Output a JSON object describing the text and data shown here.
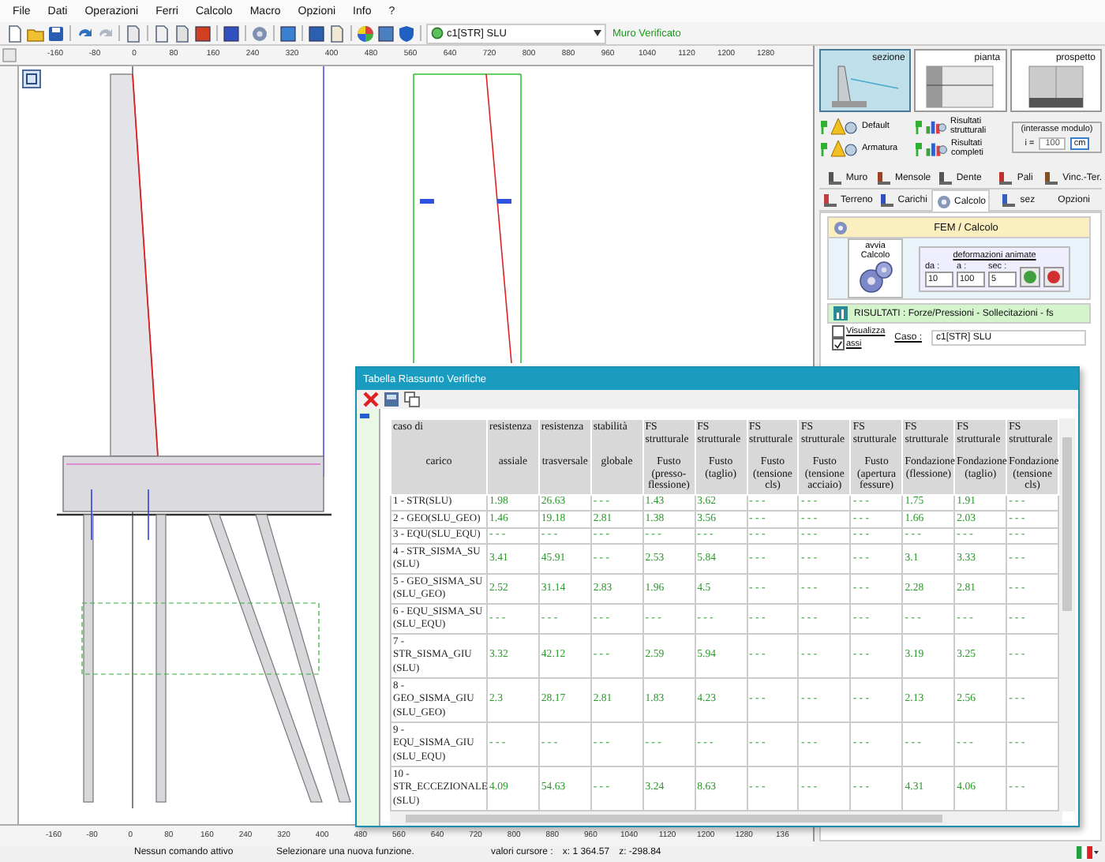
{
  "menu": [
    "File",
    "Dati",
    "Operazioni",
    "Ferri",
    "Calcolo",
    "Macro",
    "Opzioni",
    "Info",
    "?"
  ],
  "toolbar": {
    "case_select": "c1[STR] SLU",
    "status": "Muro Verificato"
  },
  "ruler": {
    "top_labels": [
      "-160",
      "-80",
      "0",
      "80",
      "160",
      "240",
      "320",
      "400",
      "480",
      "560",
      "640",
      "720",
      "800",
      "880",
      "960",
      "1040",
      "1120",
      "1200",
      "1280"
    ],
    "bottom_labels": [
      "-160",
      "-80",
      "0",
      "80",
      "160",
      "240",
      "320",
      "400",
      "480",
      "560",
      "640",
      "720",
      "800",
      "880",
      "960",
      "1040",
      "1120",
      "1200",
      "1280",
      "136"
    ]
  },
  "views": [
    {
      "label": "sezione",
      "selected": true
    },
    {
      "label": "pianta",
      "selected": false
    },
    {
      "label": "prospetto",
      "selected": false
    }
  ],
  "display_buttons": [
    {
      "label": "Default"
    },
    {
      "label": "Risultati strutturali"
    },
    {
      "label": "Armatura"
    },
    {
      "label": "Risultati completi"
    }
  ],
  "module_spacing": {
    "label": "(interasse modulo)",
    "symbol": "i =",
    "value": "100",
    "unit": "cm"
  },
  "tab_rows": [
    {
      "tabs": [
        {
          "label": "Muro",
          "kind": "icon",
          "selected": false
        },
        {
          "label": "Mensole",
          "kind": "icon",
          "selected": false
        },
        {
          "label": "Dente",
          "kind": "icon",
          "selected": false
        },
        {
          "label": "Pali",
          "kind": "icon",
          "selected": false
        },
        {
          "label": "Vinc.-Ter.",
          "kind": "icon",
          "selected": false
        }
      ]
    },
    {
      "tabs": [
        {
          "label": "Terreno",
          "kind": "icon",
          "selected": false
        },
        {
          "label": "Carichi",
          "kind": "icon",
          "selected": false
        },
        {
          "label": "Calcolo",
          "kind": "icon",
          "selected": true
        },
        {
          "label": "sez",
          "kind": "icon",
          "selected": false
        },
        {
          "label": "Opzioni",
          "kind": "text",
          "selected": false
        }
      ]
    }
  ],
  "calc_panel": {
    "title": "FEM / Calcolo",
    "start_button": "avvia Calcolo",
    "animation_title": "deformazioni animate",
    "fields": [
      {
        "label": "da :",
        "value": "10"
      },
      {
        "label": "a :",
        "value": "100"
      },
      {
        "label": "sec :",
        "value": "5"
      }
    ]
  },
  "results_panel": {
    "title": "RISULTATI : Forze/Pressioni - Sollecitazioni - fs",
    "options": [
      {
        "label": "Visualizza",
        "checked": false
      },
      {
        "label": "assi",
        "checked": true
      }
    ],
    "case_label": "Caso :",
    "case_value": "c1[STR] SLU"
  },
  "table_window": {
    "title": "Tabella Riassunto Verifiche",
    "columns": [
      {
        "top": "caso di",
        "bottom": "carico"
      },
      {
        "top": "resistenza",
        "bottom": "assiale"
      },
      {
        "top": "resistenza",
        "bottom": "trasversale"
      },
      {
        "top": "stabilità",
        "bottom": "globale"
      },
      {
        "top": "FS strutturale",
        "bottom": "Fusto (presso-flessione)"
      },
      {
        "top": "FS strutturale",
        "bottom": "Fusto (taglio)"
      },
      {
        "top": "FS strutturale",
        "bottom": "Fusto (tensione cls)"
      },
      {
        "top": "FS strutturale",
        "bottom": "Fusto (tensione acciaio)"
      },
      {
        "top": "FS strutturale",
        "bottom": "Fusto (apertura fessure)"
      },
      {
        "top": "FS strutturale",
        "bottom": "Fondazione (flessione)"
      },
      {
        "top": "FS strutturale",
        "bottom": "Fondazione (taglio)"
      },
      {
        "top": "FS strutturale",
        "bottom": "Fondazione (tensione cls)"
      }
    ],
    "rows": [
      {
        "case": "1 - STR(SLU)",
        "values": [
          "1.98",
          "26.63",
          "- - -",
          "1.43",
          "3.62",
          "- - -",
          "- - -",
          "- - -",
          "1.75",
          "1.91",
          "- - -"
        ]
      },
      {
        "case": "2 - GEO(SLU_GEO)",
        "values": [
          "1.46",
          "19.18",
          "2.81",
          "1.38",
          "3.56",
          "- - -",
          "- - -",
          "- - -",
          "1.66",
          "2.03",
          "- - -"
        ]
      },
      {
        "case": "3 - EQU(SLU_EQU)",
        "values": [
          "- - -",
          "- - -",
          "- - -",
          "- - -",
          "- - -",
          "- - -",
          "- - -",
          "- - -",
          "- - -",
          "- - -",
          "- - -"
        ]
      },
      {
        "case": "4 - STR_SISMA_SU (SLU)",
        "values": [
          "3.41",
          "45.91",
          "- - -",
          "2.53",
          "5.84",
          "- - -",
          "- - -",
          "- - -",
          "3.1",
          "3.33",
          "- - -"
        ]
      },
      {
        "case": "5 - GEO_SISMA_SU (SLU_GEO)",
        "values": [
          "2.52",
          "31.14",
          "2.83",
          "1.96",
          "4.5",
          "- - -",
          "- - -",
          "- - -",
          "2.28",
          "2.81",
          "- - -"
        ]
      },
      {
        "case": "6 - EQU_SISMA_SU (SLU_EQU)",
        "values": [
          "- - -",
          "- - -",
          "- - -",
          "- - -",
          "- - -",
          "- - -",
          "- - -",
          "- - -",
          "- - -",
          "- - -",
          "- - -"
        ]
      },
      {
        "case": "7 - STR_SISMA_GIU (SLU)",
        "values": [
          "3.32",
          "42.12",
          "- - -",
          "2.59",
          "5.94",
          "- - -",
          "- - -",
          "- - -",
          "3.19",
          "3.25",
          "- - -"
        ]
      },
      {
        "case": "8 - GEO_SISMA_GIU (SLU_GEO)",
        "values": [
          "2.3",
          "28.17",
          "2.81",
          "1.83",
          "4.23",
          "- - -",
          "- - -",
          "- - -",
          "2.13",
          "2.56",
          "- - -"
        ]
      },
      {
        "case": "9 - EQU_SISMA_GIU (SLU_EQU)",
        "values": [
          "- - -",
          "- - -",
          "- - -",
          "- - -",
          "- - -",
          "- - -",
          "- - -",
          "- - -",
          "- - -",
          "- - -",
          "- - -"
        ]
      },
      {
        "case": "10 - STR_ECCEZIONALE (SLU)",
        "values": [
          "4.09",
          "54.63",
          "- - -",
          "3.24",
          "8.63",
          "- - -",
          "- - -",
          "- - -",
          "4.31",
          "4.06",
          "- - -"
        ]
      }
    ]
  },
  "status_bar": {
    "command": "Nessun comando attivo",
    "hint": "Selezionare una nuova funzione.",
    "cursor_label": "valori cursore :",
    "x_value": "x: 1 364.57",
    "z_value": "z: -298.84"
  }
}
